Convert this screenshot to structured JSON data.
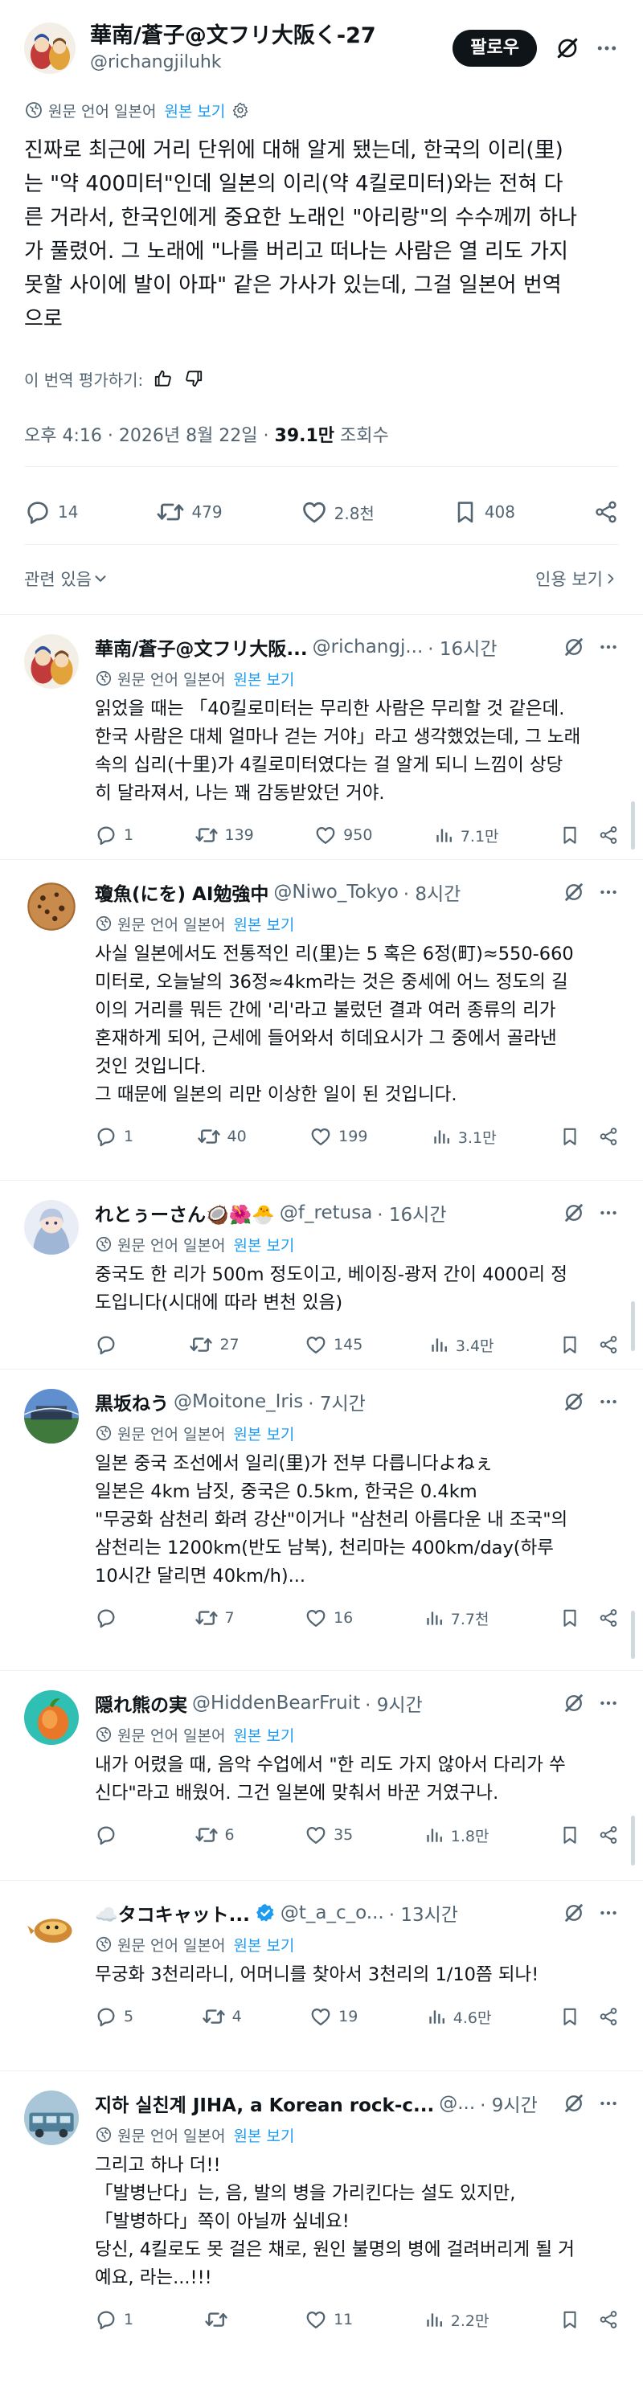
{
  "main": {
    "name": "華南/蒼子@文フリ大阪く-27",
    "handle": "@richangjiluhk",
    "follow_label": "팔로우",
    "translate": {
      "globe": "원문 언어 일본어",
      "link": "원본 보기"
    },
    "text": "진짜로 최근에 거리 단위에 대해 알게 됐는데, 한국의 이리(里)\n는 \"약 400미터\"인데 일본의 이리(약 4킬로미터)와는 전혀 다\n른 거라서, 한국인에게 중요한 노래인 \"아리랑\"의 수수께끼 하나\n가 풀렸어. 그 노래에 \"나를 버리고 떠나는 사람은 열 리도 가지\n못할 사이에 발이 아파\" 같은 가사가 있는데, 그걸 일본어 번역\n으로",
    "rate_label": "이 번역 평가하기:",
    "meta_time": "오후 4:16 · 2026년 8월 22일 · ",
    "meta_views": "39.1만",
    "meta_views_label": " 조회수",
    "stats": {
      "replies": "14",
      "retweets": "479",
      "likes": "2.8천",
      "bookmarks": "408"
    },
    "related_label": "관련 있음",
    "quotes_label": "인용 보기"
  },
  "replies": [
    {
      "name": "華南/蒼子@文フリ大阪...",
      "handle": "@richangj...",
      "time": "· 16시간",
      "translate_globe": "원문 언어 일본어",
      "translate_link": "원본 보기",
      "text": "읽었을 때는 「40킬로미터는 무리한 사람은 무리할 것 같은데.\n한국 사람은 대체 얼마나 걷는 거야」라고 생각했었는데, 그 노래\n속의 십리(十里)가 4킬로미터였다는 걸 알게 되니 느낌이 상당\n히 달라져서, 나는 꽤 감동받았던 거야.",
      "replies": "1",
      "retweets": "139",
      "likes": "950",
      "views": "7.1만"
    },
    {
      "name": "瓊魚(にを) AI勉強中",
      "handle": "@Niwo_Tokyo",
      "time": "· 8시간",
      "translate_globe": "원문 언어 일본어",
      "translate_link": "원본 보기",
      "text": "사실 일본에서도 전통적인 리(里)는 5 혹은 6정(町)≈550-660\n미터로, 오늘날의 36정≈4km라는 것은 중세에 어느 정도의 길\n이의 거리를 뭐든 간에 '리'라고 불렀던 결과 여러 종류의 리가\n혼재하게 되어, 근세에 들어와서 히데요시가 그 중에서 골라낸\n것인 것입니다.\n그 때문에 일본의 리만 이상한 일이 된 것입니다.",
      "replies": "1",
      "retweets": "40",
      "likes": "199",
      "views": "3.1만"
    },
    {
      "name": "れとぅーさん🥥🌺🐣",
      "handle": "@f_retusa",
      "time": "· 16시간",
      "translate_globe": "원문 언어 일본어",
      "translate_link": "원본 보기",
      "text": "중국도 한 리가 500m 정도이고, 베이징-광저 간이 4000리 정\n도입니다(시대에 따라 변천 있음)",
      "replies": "",
      "retweets": "27",
      "likes": "145",
      "views": "3.4만"
    },
    {
      "name": "黒坂ねう",
      "handle": "@Moitone_Iris",
      "time": "· 7시간",
      "translate_globe": "원문 언어 일본어",
      "translate_link": "원본 보기",
      "text": "일본 중국 조선에서 일리(里)가 전부 다릅니다よねぇ\n일본은 4km 남짓, 중국은 0.5km, 한국은 0.4km\n\"무궁화 삼천리 화려 강산\"이거나 \"삼천리 아름다운 내 조국\"의\n삼천리는 1200km(반도 남북), 천리마는 400km/day(하루\n10시간 달리면 40km/h)...",
      "replies": "",
      "retweets": "7",
      "likes": "16",
      "views": "7.7천"
    },
    {
      "name": "隠れ熊の実",
      "handle": "@HiddenBearFruit",
      "time": "· 9시간",
      "translate_globe": "원문 언어 일본어",
      "translate_link": "원본 보기",
      "text": "내가 어렸을 때, 음악 수업에서 \"한 리도 가지 않아서 다리가 쑤\n신다\"라고 배웠어. 그건 일본에 맞춰서 바꾼 거였구나.",
      "replies": "",
      "retweets": "6",
      "likes": "35",
      "views": "1.8만"
    },
    {
      "name": "☁️タコキャット...",
      "handle": "@t_a_c_o...",
      "time": "· 13시간",
      "translate_globe": "원문 언어 일본어",
      "translate_link": "원본 보기",
      "text": "무궁화 3천리라니, 어머니를 찾아서 3천리의 1/10쯤 되나!",
      "replies": "5",
      "retweets": "4",
      "likes": "19",
      "views": "4.6만"
    },
    {
      "name": "지하 실친계 JIHA, a Korean rock-c...",
      "handle": "@...",
      "time": "· 9시간",
      "translate_globe": "원문 언어 일본어",
      "translate_link": "원본 보기",
      "text": "그리고 하나 더!!\n「발병난다」는, 음, 발의 병을 가리킨다는 설도 있지만,\n「발병하다」쪽이 아닐까 싶네요!\n당신, 4킬로도 못 걸은 채로, 원인 불명의 병에 걸려버리게 될 거\n예요, 라는...!!!",
      "replies": "1",
      "retweets": "",
      "likes": "11",
      "views": "2.2만"
    }
  ],
  "icons": {
    "grok": "grok-icon",
    "more": "more-icon",
    "globe": "globe-icon",
    "gear": "gear-icon",
    "reply": "reply-icon",
    "retweet": "retweet-icon",
    "like": "like-icon",
    "bookmark": "bookmark-icon",
    "share": "share-icon",
    "views": "views-icon",
    "verified": "verified-icon",
    "thumbs_up": "thumbs-up-icon",
    "thumbs_down": "thumbs-down-icon"
  },
  "colors": {
    "link": "#1d9bf0",
    "secondary": "#536471",
    "primary": "#0f1419",
    "verified": "#1d9bf0"
  }
}
